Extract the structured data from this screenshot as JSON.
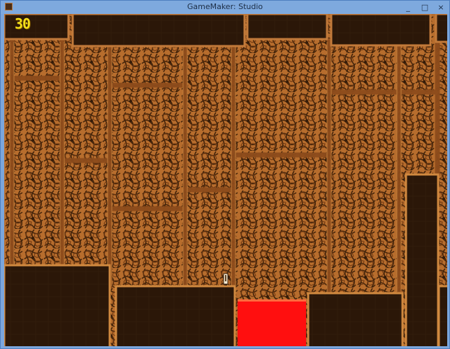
{
  "window": {
    "title": "GameMaker: Studio",
    "controls": [
      "_",
      "□",
      "×"
    ]
  },
  "hud": {
    "score": "30"
  },
  "colors": {
    "rock": "#b76d2d",
    "dark": "#2b1708",
    "edge": "#d8893f",
    "lava": "#ff0f0f"
  },
  "icons": [
    "minimize-icon",
    "maximize-icon",
    "close-icon",
    "player-icon"
  ]
}
